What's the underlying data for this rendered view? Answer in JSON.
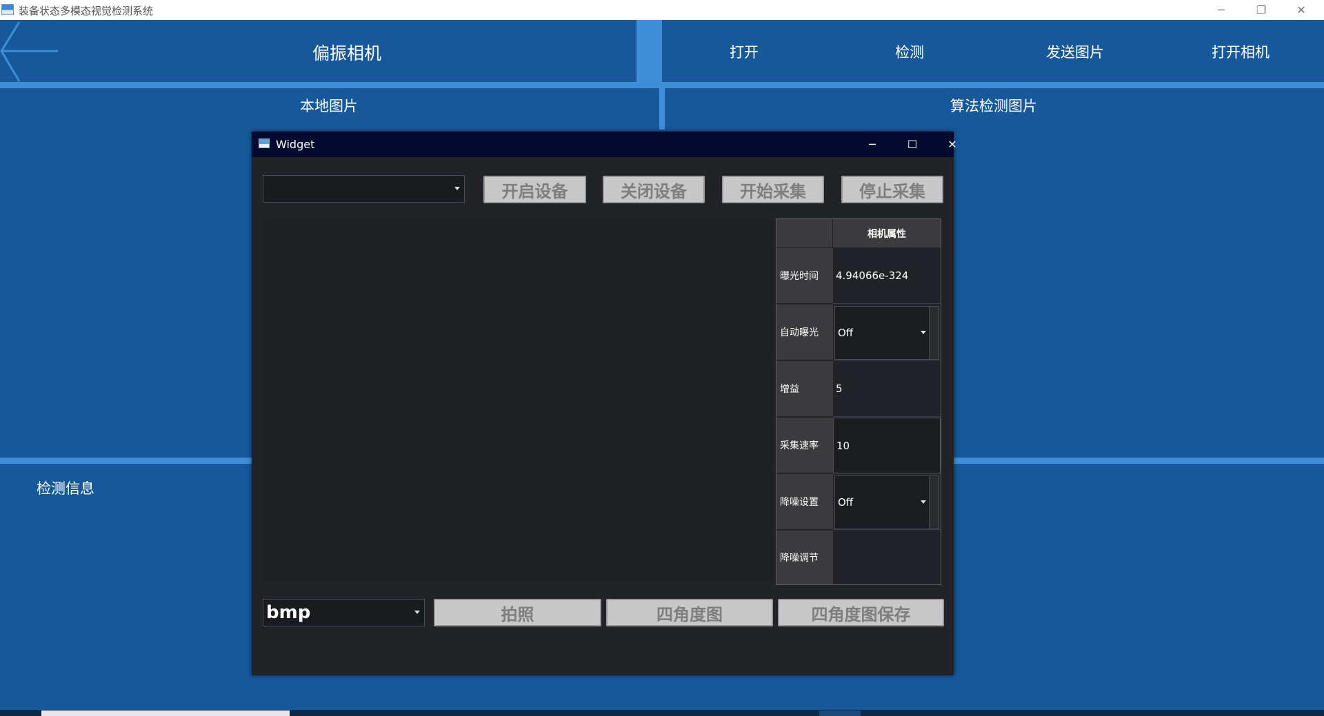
{
  "window": {
    "title": "装备状态多模态视觉检测系统",
    "controls": {
      "minimize": "─",
      "restore": "❐",
      "close": "✕"
    }
  },
  "header": {
    "title": "偏振相机",
    "nav": [
      "打开",
      "检测",
      "发送图片",
      "打开相机"
    ]
  },
  "sections": {
    "local_image": "本地图片",
    "detect_image": "算法检测图片",
    "detect_info": "检测信息"
  },
  "dialog": {
    "title": "Widget",
    "controls": {
      "minimize": "─",
      "maximize": "☐",
      "close": "✕"
    },
    "device_select": "",
    "buttons": {
      "open_device": "开启设备",
      "close_device": "关闭设备",
      "start_capture": "开始采集",
      "stop_capture": "停止采集",
      "photo": "拍照",
      "four_angle": "四角度图",
      "four_angle_save": "四角度图保存"
    },
    "format_select": "bmp",
    "properties": {
      "header": "相机属性",
      "rows": [
        {
          "name": "曝光时间",
          "value": "4.94066e-324",
          "kind": "text"
        },
        {
          "name": "自动曝光",
          "value": "Off",
          "kind": "combo"
        },
        {
          "name": "增益",
          "value": "5",
          "kind": "text"
        },
        {
          "name": "采集速率",
          "value": "10",
          "kind": "edit"
        },
        {
          "name": "降噪设置",
          "value": "Off",
          "kind": "combo"
        },
        {
          "name": "降噪调节",
          "value": "",
          "kind": "text"
        }
      ]
    }
  }
}
